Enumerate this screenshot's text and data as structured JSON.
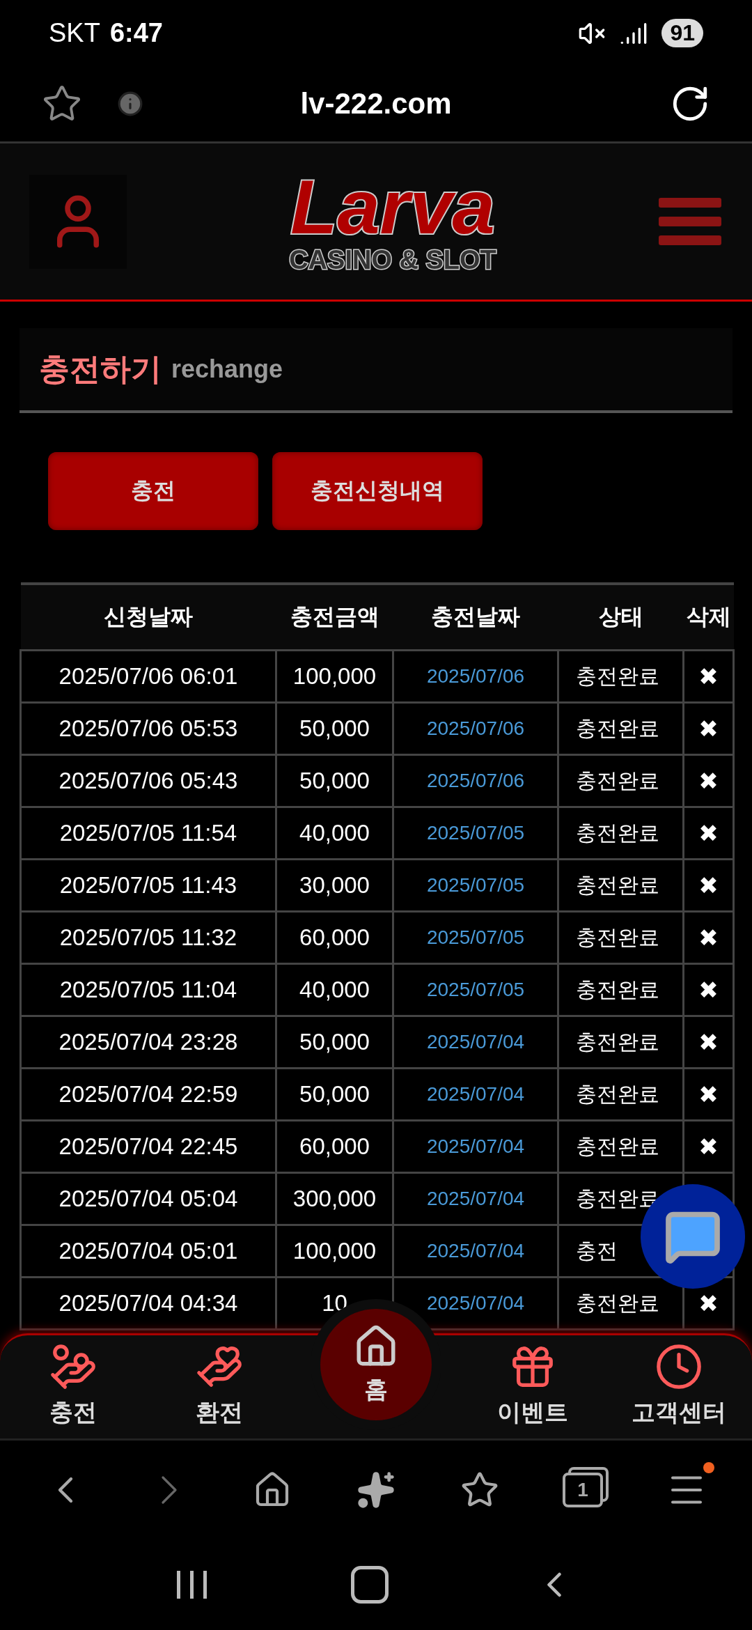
{
  "status_bar": {
    "carrier": "SKT",
    "time": "6:47",
    "battery": "91"
  },
  "browser": {
    "url": "lv-222.com",
    "tab_count": "1"
  },
  "logo": {
    "name": "Larva",
    "tagline": "CASINO & SLOT"
  },
  "panel": {
    "title": "충전하기",
    "subtitle": "rechange"
  },
  "actions": [
    {
      "label": "충전"
    },
    {
      "label": "충전신청내역"
    }
  ],
  "table": {
    "columns": [
      "신청날짜",
      "충전금액",
      "충전날짜",
      "상태",
      "삭제"
    ],
    "rows": [
      [
        "2025/07/06 06:01",
        "100,000",
        "2025/07/06",
        "충전완료",
        "✖"
      ],
      [
        "2025/07/06 05:53",
        "50,000",
        "2025/07/06",
        "충전완료",
        "✖"
      ],
      [
        "2025/07/06 05:43",
        "50,000",
        "2025/07/06",
        "충전완료",
        "✖"
      ],
      [
        "2025/07/05 11:54",
        "40,000",
        "2025/07/05",
        "충전완료",
        "✖"
      ],
      [
        "2025/07/05 11:43",
        "30,000",
        "2025/07/05",
        "충전완료",
        "✖"
      ],
      [
        "2025/07/05 11:32",
        "60,000",
        "2025/07/05",
        "충전완료",
        "✖"
      ],
      [
        "2025/07/05 11:04",
        "40,000",
        "2025/07/05",
        "충전완료",
        "✖"
      ],
      [
        "2025/07/04 23:28",
        "50,000",
        "2025/07/04",
        "충전완료",
        "✖"
      ],
      [
        "2025/07/04 22:59",
        "50,000",
        "2025/07/04",
        "충전완료",
        "✖"
      ],
      [
        "2025/07/04 22:45",
        "60,000",
        "2025/07/04",
        "충전완료",
        "✖"
      ],
      [
        "2025/07/04 05:04",
        "300,000",
        "2025/07/04",
        "충전완료",
        ""
      ],
      [
        "2025/07/04 05:01",
        "100,000",
        "2025/07/04",
        "충전",
        ""
      ],
      [
        "2025/07/04 04:34",
        "10",
        "2025/07/04",
        "충전완료",
        "✖"
      ]
    ]
  },
  "bottom_nav": [
    {
      "label": "충전",
      "kind": "side"
    },
    {
      "label": "환전",
      "kind": "side"
    },
    {
      "label": "홈",
      "kind": "center"
    },
    {
      "label": "이벤트",
      "kind": "side"
    },
    {
      "label": "고객센터",
      "kind": "side"
    }
  ]
}
